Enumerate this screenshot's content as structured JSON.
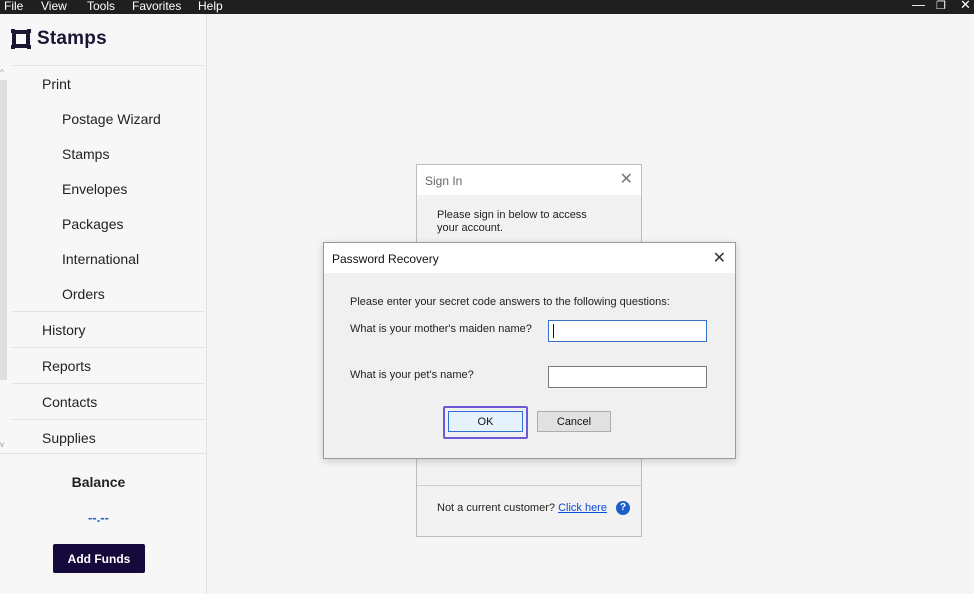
{
  "menubar": {
    "items": [
      "File",
      "View",
      "Tools",
      "Favorites",
      "Help"
    ],
    "window_controls": {
      "minimize": "—",
      "restore": "❐",
      "close": "✕"
    }
  },
  "sidebar": {
    "logo_text": "Stamps",
    "nav": {
      "print": "Print",
      "print_sub": [
        "Postage Wizard",
        "Stamps",
        "Envelopes",
        "Packages",
        "International",
        "Orders"
      ],
      "history": "History",
      "reports": "Reports",
      "contacts": "Contacts",
      "supplies": "Supplies"
    },
    "balance_label": "Balance",
    "balance_value": "--.--",
    "add_funds_label": "Add Funds"
  },
  "signin_dialog": {
    "title": "Sign In",
    "close": "✕",
    "message": "Please sign in below to access your account.",
    "footer_text": "Not a current customer?",
    "footer_link": "Click here",
    "help": "?"
  },
  "password_recovery": {
    "title": "Password Recovery",
    "close": "✕",
    "message": "Please enter your secret code answers to the following questions:",
    "q1_label": "What is your mother's maiden name?",
    "q1_value": "",
    "q2_label": "What is your pet's name?",
    "q2_value": "",
    "ok_label": "OK",
    "cancel_label": "Cancel"
  },
  "colors": {
    "brand_dark": "#160a3c",
    "link": "#0b4bd6",
    "balance": "#2860c4",
    "focus_ring": "#6a5ad8"
  }
}
